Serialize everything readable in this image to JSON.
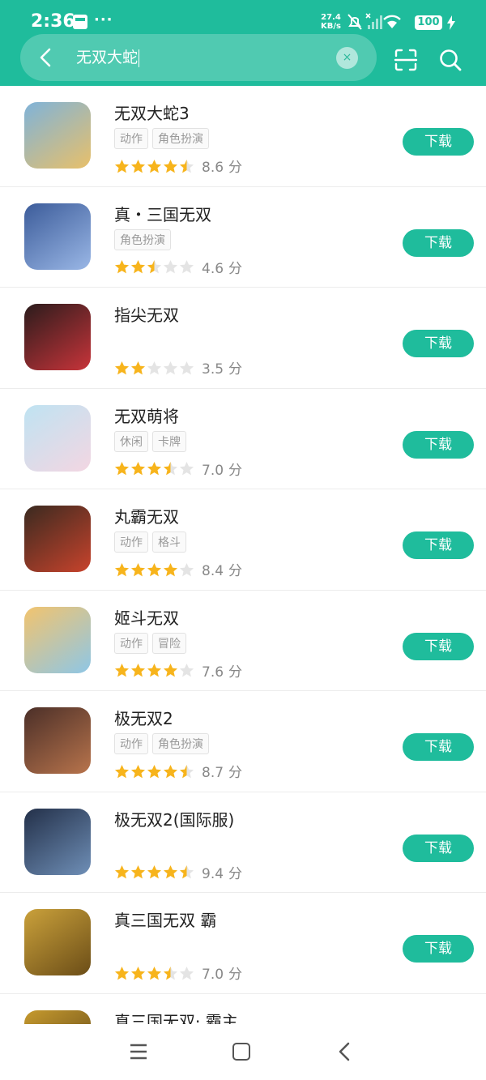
{
  "status_bar": {
    "time": "2:36",
    "dots": "···",
    "net_speed": "27.4",
    "net_unit": "KB/s",
    "battery": "100"
  },
  "search": {
    "query": "无双大蛇",
    "clear_label": "×"
  },
  "download_label": "下载",
  "score_unit": "分",
  "colors": {
    "brand": "#1fbc9c",
    "star_on": "#f7b41c",
    "star_off": "#e4e4e4"
  },
  "apps": [
    {
      "name": "无双大蛇3",
      "tags": [
        "动作",
        "角色扮演"
      ],
      "rating": 4.5,
      "score": "8.6"
    },
    {
      "name": "真・三国无双",
      "tags": [
        "角色扮演"
      ],
      "rating": 2.5,
      "score": "4.6"
    },
    {
      "name": "指尖无双",
      "tags": [],
      "rating": 2,
      "score": "3.5"
    },
    {
      "name": "无双萌将",
      "tags": [
        "休闲",
        "卡牌"
      ],
      "rating": 3.5,
      "score": "7.0"
    },
    {
      "name": "丸霸无双",
      "tags": [
        "动作",
        "格斗"
      ],
      "rating": 4,
      "score": "8.4"
    },
    {
      "name": "姬斗无双",
      "tags": [
        "动作",
        "冒险"
      ],
      "rating": 4,
      "score": "7.6"
    },
    {
      "name": "极无双2",
      "tags": [
        "动作",
        "角色扮演"
      ],
      "rating": 4.5,
      "score": "8.7"
    },
    {
      "name": "极无双2(国际服)",
      "tags": [],
      "rating": 4.5,
      "score": "9.4"
    },
    {
      "name": "真三国无双 霸",
      "tags": [],
      "rating": 3.5,
      "score": "7.0"
    },
    {
      "name": "真三国无双· 霸主",
      "tags": [],
      "rating": 0,
      "score": ""
    }
  ],
  "nav": {
    "menu_icon": "menu-icon",
    "home_icon": "home-icon",
    "back_icon": "back-icon"
  }
}
